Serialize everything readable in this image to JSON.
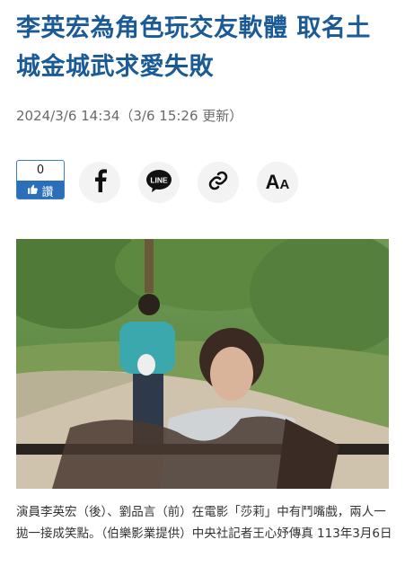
{
  "article": {
    "title": "李英宏為角色玩交友軟體 取名土城金城武求愛失敗",
    "timestamp": "2024/3/6 14:34（3/6 15:26 更新）",
    "caption": "演員李英宏（後）、劉品言（前）在電影「莎莉」中有鬥嘴戲，兩人一拋一接成笑點。（伯樂影業提供）中央社記者王心妤傳真 113年3月6日"
  },
  "share": {
    "like_count": "0",
    "like_label": "讚",
    "font_label_big": "A",
    "font_label_small": "A",
    "line_label": "LINE"
  },
  "icons": [
    "thumbs-up-icon",
    "facebook-icon",
    "line-icon",
    "link-icon",
    "font-size-icon"
  ],
  "colors": {
    "headline": "#1a5a96",
    "like_blue": "#2a6fb8"
  }
}
